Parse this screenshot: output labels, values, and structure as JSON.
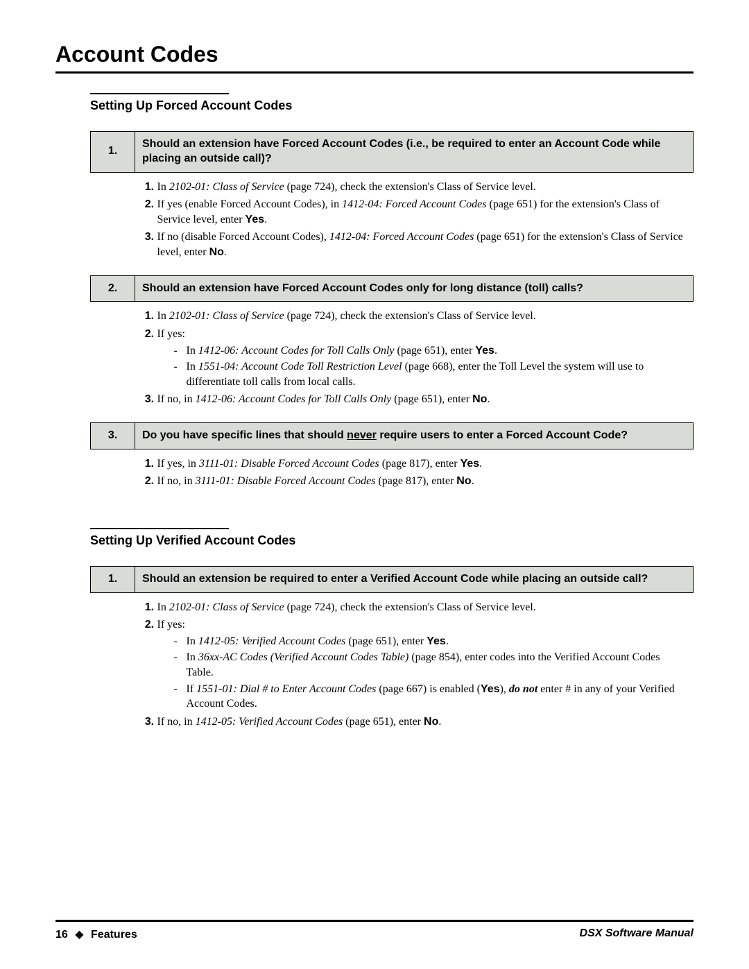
{
  "pageTitle": "Account Codes",
  "sections": [
    {
      "heading": "Setting Up Forced Account Codes",
      "qa": [
        {
          "num": "1.",
          "question": "Should an extension have Forced Account Codes (i.e., be required to enter an Account Code while placing an outside call)?",
          "answersHTML": [
            "In <span class='ital'>2102-01: Class of Service</span> (page 724), check the extension's Class of Service level.",
            "If yes (enable Forced Account Codes), in <span class='ital'>1412-04: Forced Account Codes</span> (page 651) for the extension's Class of Service level, enter <span class='bold'>Yes</span>.",
            "If no (disable Forced Account Codes), <span class='ital'>1412-04: Forced Account Codes</span> (page 651) for the extension's Class of Service level, enter <span class='bold'>No</span>."
          ]
        },
        {
          "num": "2.",
          "question": "Should an extension have Forced Account Codes only for long distance (toll) calls?",
          "answersHTML": [
            "In <span class='ital'>2102-01: Class of Service</span> (page 724), check the extension's Class of Service level.",
            "If yes:<ul class='sub-dash'><li>In <span class='ital'>1412-06: Account Codes for Toll Calls Only</span> (page 651), enter <span class='bold'>Yes</span>.</li><li>In <span class='ital'>1551-04: Account Code Toll Restriction Level</span> (page 668), enter the Toll Level the system will use to differentiate toll calls from local calls.</li></ul>",
            "If no, in <span class='ital'>1412-06: Account Codes for Toll Calls Only</span> (page 651), enter <span class='bold'>No</span>."
          ]
        },
        {
          "num": "3.",
          "questionHTML": "Do you have specific lines that should <span class='uline'>never</span> require users to enter a Forced Account Code?",
          "answersHTML": [
            "If yes, in <span class='ital'>3111-01: Disable Forced Account Codes</span> (page 817), enter <span class='bold'>Yes</span>.",
            "If no, in <span class='ital'>3111-01: Disable Forced Account Codes</span> (page 817), enter <span class='bold'>No</span>."
          ]
        }
      ]
    },
    {
      "heading": "Setting Up Verified Account Codes",
      "qa": [
        {
          "num": "1.",
          "question": "Should an extension be required to enter a Verified Account Code while placing an outside call?",
          "answersHTML": [
            "In <span class='ital'>2102-01: Class of Service</span> (page 724), check the extension's Class of Service level.",
            "If yes:<ul class='sub-dash'><li>In <span class='ital'>1412-05: Verified Account Codes</span> (page 651), enter <span class='bold'>Yes</span>.</li><li>In <span class='ital'>36xx-AC Codes (Verified Account Codes Table)</span> (page 854), enter codes into the Verified Account Codes Table.</li><li>If <span class='ital'>1551-01: Dial # to Enter Account Codes</span> (page 667) is enabled (<span class='bold'>Yes</span>), <span class='bolditalic'>do not</span> enter # in any of your Verified Account Codes.</li></ul>",
            "If no, in <span class='ital'>1412-05: Verified Account Codes</span> (page 651), enter <span class='bold'>No</span>."
          ]
        }
      ]
    }
  ],
  "footer": {
    "pageNum": "16",
    "diamond": "◆",
    "features": "Features",
    "manual": "DSX Software Manual"
  }
}
